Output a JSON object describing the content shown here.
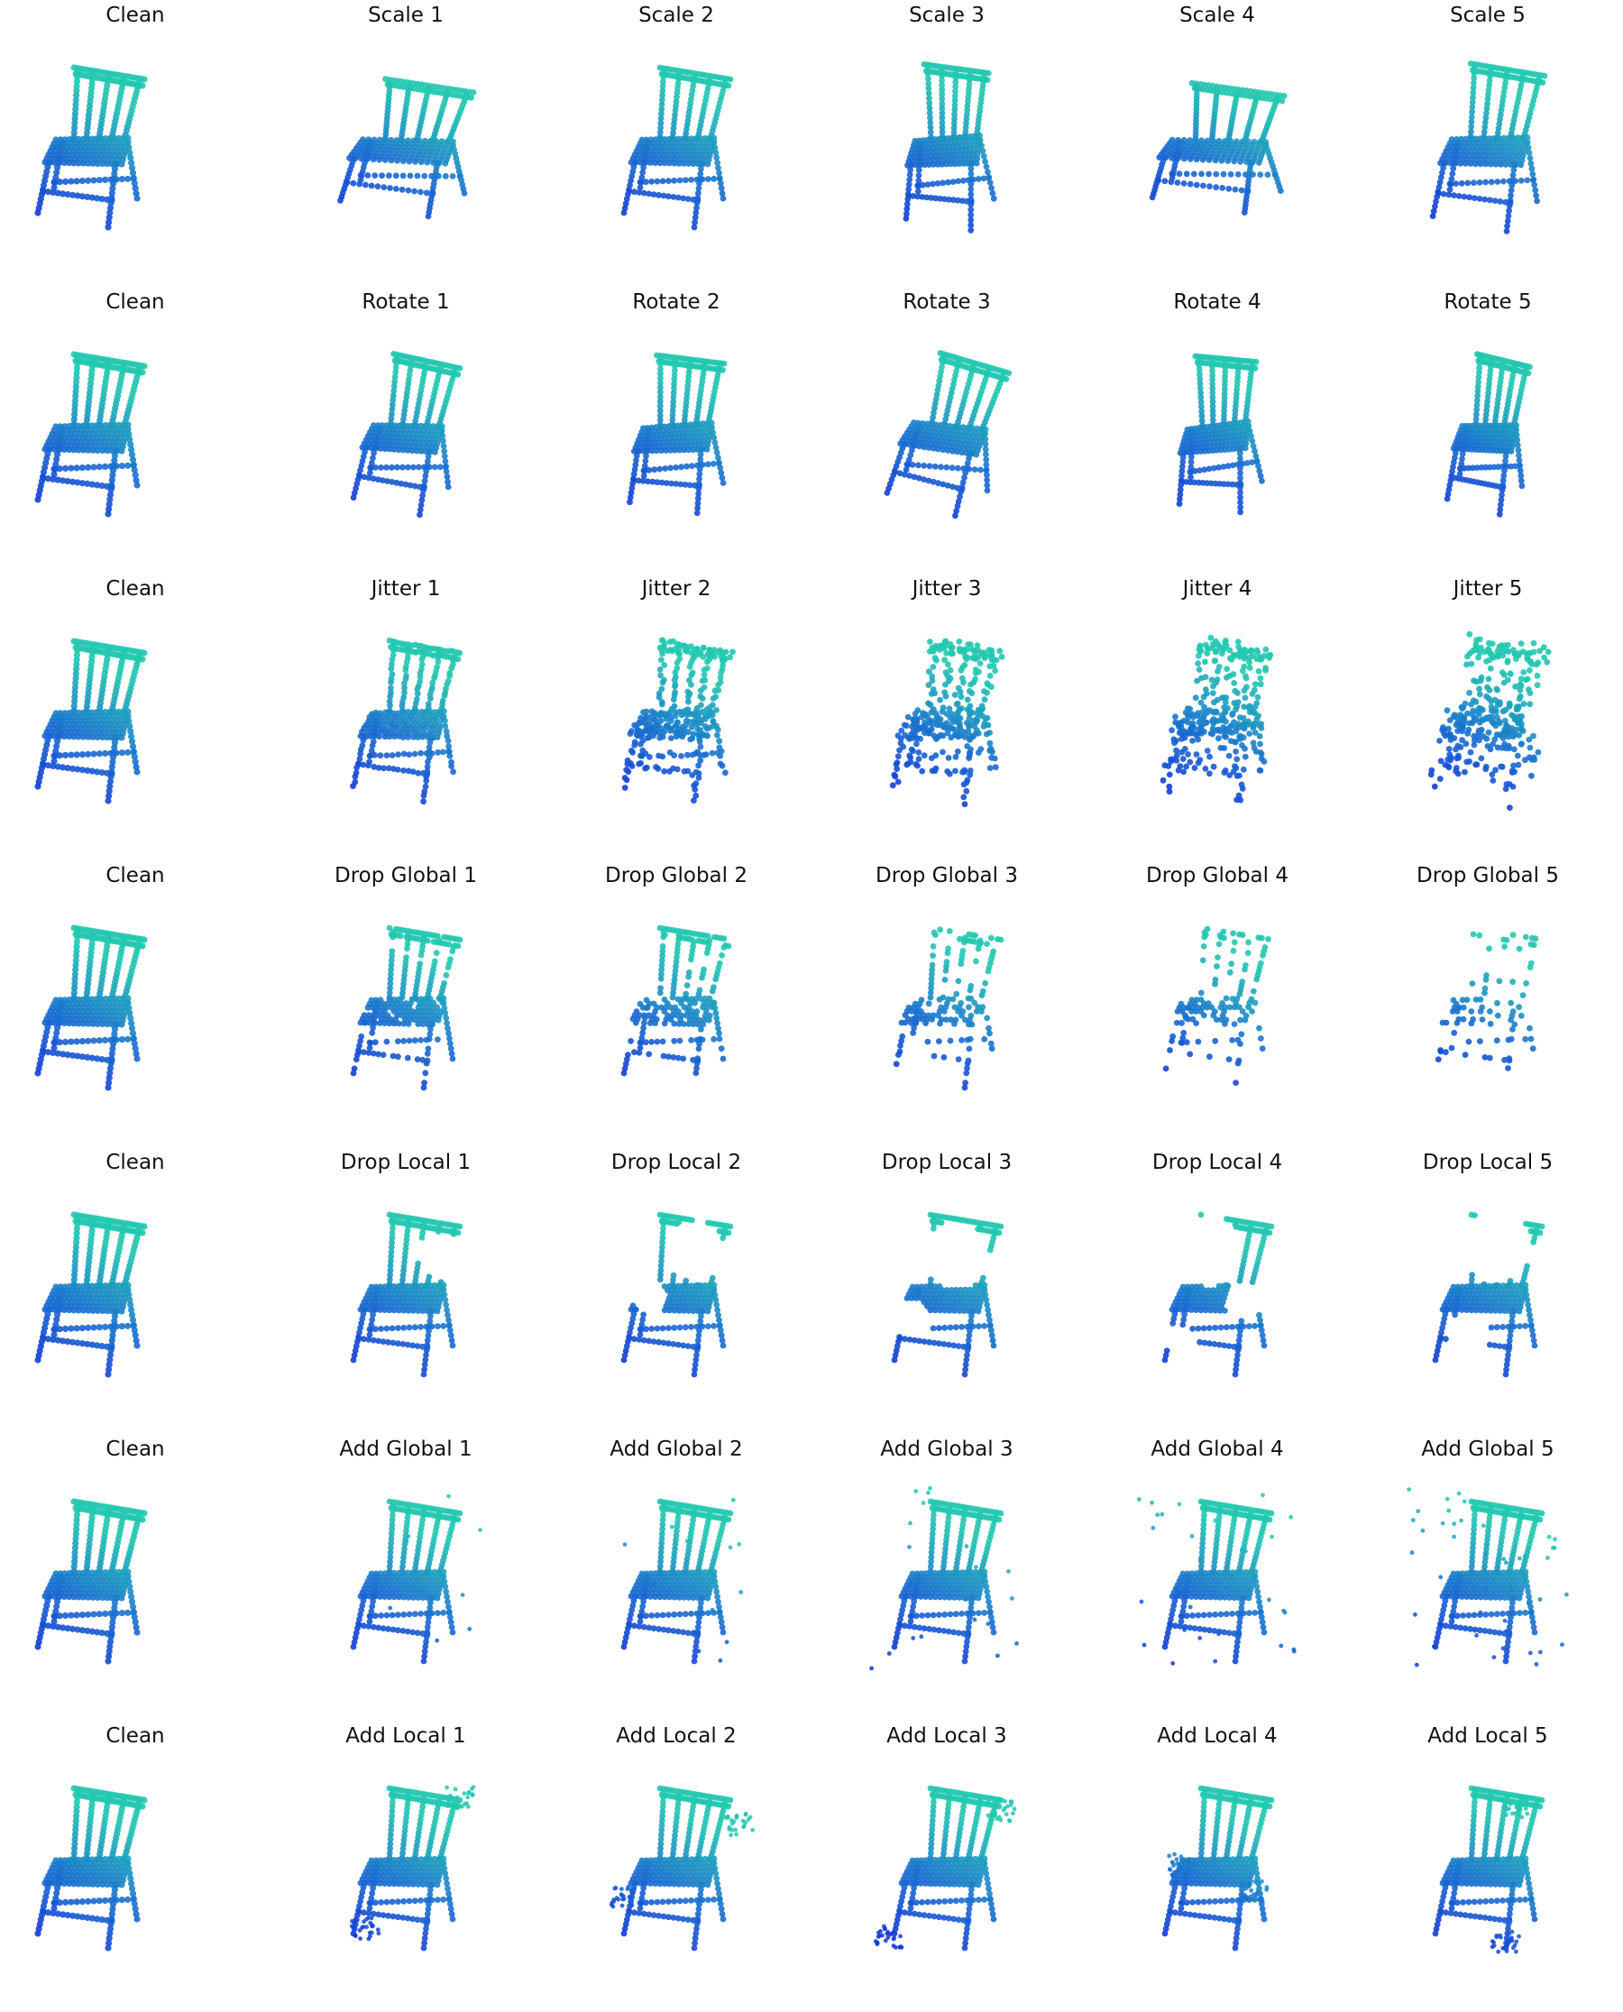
{
  "figure": {
    "rows": [
      {
        "corruption": "scale",
        "titles": [
          "Clean",
          "Scale 1",
          "Scale 2",
          "Scale 3",
          "Scale 4",
          "Scale 5"
        ]
      },
      {
        "corruption": "rotate",
        "titles": [
          "Clean",
          "Rotate 1",
          "Rotate 2",
          "Rotate 3",
          "Rotate 4",
          "Rotate 5"
        ]
      },
      {
        "corruption": "jitter",
        "titles": [
          "Clean",
          "Jitter 1",
          "Jitter 2",
          "Jitter 3",
          "Jitter 4",
          "Jitter 5"
        ]
      },
      {
        "corruption": "drop-global",
        "titles": [
          "Clean",
          "Drop Global 1",
          "Drop Global 2",
          "Drop Global 3",
          "Drop Global 4",
          "Drop Global 5"
        ]
      },
      {
        "corruption": "drop-local",
        "titles": [
          "Clean",
          "Drop Local 1",
          "Drop Local 2",
          "Drop Local 3",
          "Drop Local 4",
          "Drop Local 5"
        ]
      },
      {
        "corruption": "add-global",
        "titles": [
          "Clean",
          "Add Global 1",
          "Add Global 2",
          "Add Global 3",
          "Add Global 4",
          "Add Global 5"
        ]
      },
      {
        "corruption": "add-local",
        "titles": [
          "Clean",
          "Add Local 1",
          "Add Local 2",
          "Add Local 3",
          "Add Local 4",
          "Add Local 5"
        ]
      }
    ],
    "colors": {
      "low": "#1233d8",
      "mid": "#1a6fd0",
      "high": "#22c8b0",
      "background": "#ffffff",
      "title_text": "#111111"
    }
  }
}
